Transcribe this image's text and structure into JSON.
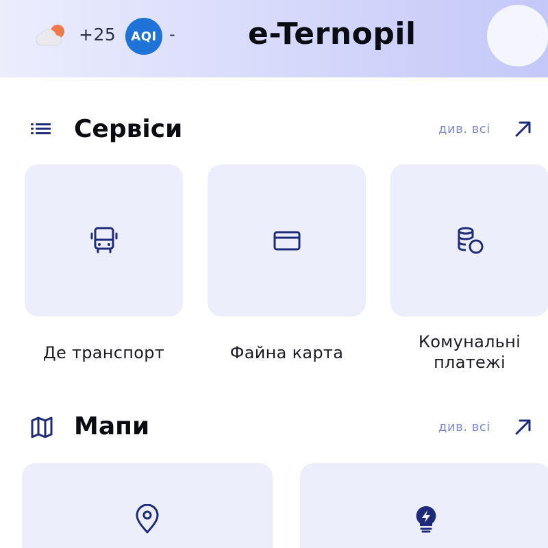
{
  "header": {
    "weather_icon": "cloud-sun-icon",
    "temperature": "+25",
    "aqi_label": "AQI",
    "aqi_value": "-",
    "app_title": "e-Ternopil",
    "avatar_icon": "profile-avatar"
  },
  "services": {
    "icon": "list-icon",
    "title": "Сервіси",
    "see_all": "див. всі",
    "items": [
      {
        "label": "Де транспорт",
        "icon": "bus-icon"
      },
      {
        "label": "Файна карта",
        "icon": "card-icon"
      },
      {
        "label": "Комунальні\nплатежі",
        "icon": "coins-icon"
      }
    ]
  },
  "maps": {
    "icon": "map-icon",
    "title": "Мапи",
    "see_all": "див. всі",
    "items": [
      {
        "icon": "location-pin-icon"
      },
      {
        "icon": "lightbulb-icon"
      }
    ]
  },
  "colors": {
    "accent": "#1f2a7a",
    "aqi_badge": "#1f73d6",
    "link": "#7f8bd1",
    "tile_bg": "#eceefb"
  }
}
